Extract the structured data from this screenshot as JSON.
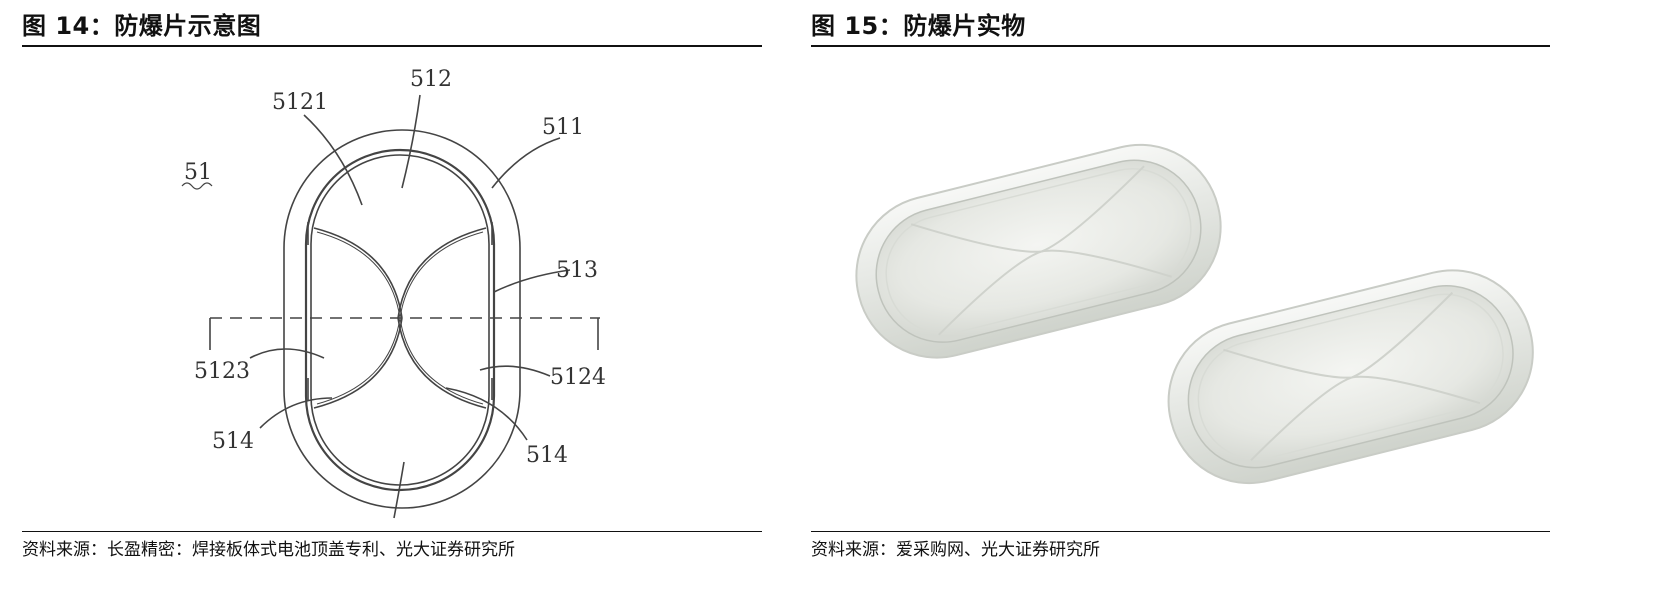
{
  "left": {
    "title": "图 14：防爆片示意图",
    "source": "资料来源：长盈精密：焊接板体式电池顶盖专利、光大证券研究所",
    "labels": {
      "l512": "512",
      "l5121": "5121",
      "l511": "511",
      "l51": "51",
      "l513": "513",
      "l5123": "5123",
      "l5124": "5124",
      "l514a": "514",
      "l514b": "514"
    }
  },
  "right": {
    "title": "图 15：防爆片实物",
    "source": "资料来源：爱采购网、光大证券研究所"
  }
}
